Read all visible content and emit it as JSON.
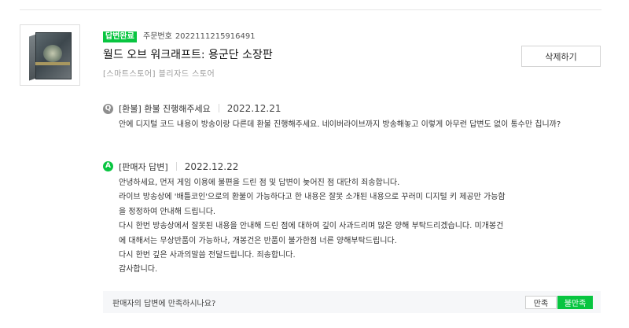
{
  "order": {
    "status_badge": "답변완료",
    "order_label": "주문번호",
    "order_number": "2022111215916491",
    "product_title": "월드 오브 워크래프트: 용군단 소장판",
    "store_name": "[스마트스토어] 블리자드 스토어",
    "delete_label": "삭제하기"
  },
  "question": {
    "badge": "Q",
    "category": "[환불] 환불 진행해주세요",
    "date": "2022.12.21",
    "body": "안에 디지털 코드 내용이 방송이랑 다른데 환불 진행해주세요. 네이버라이브까지 방송해놓고 이렇게 아무런 답변도 없이 통수만 칩니까?"
  },
  "answer": {
    "badge": "A",
    "category": "[판매자 답변]",
    "date": "2022.12.22",
    "lines": [
      "안녕하세요, 먼저 게임 이용에 불편을 드린 점 및 답변이 늦어진 점 대단히 죄송합니다.",
      "라이브 방송상에 '배틀코인'으로의 환불이 가능하다고 한 내용은 잘못 소개된 내용으로 꾸러미 디지털 키 제공만 가능함",
      "을 정정하여 안내해 드립니다.",
      "다시 한번 방송상에서 잘못된 내용을 안내해 드린 점에 대하여 깊이 사과드리며 많은 양해 부탁드리겠습니다. 미개봉건",
      "에 대해서는 무상반품이 가능하나, 개봉건은 반품이 불가한점 너른 양해부탁드립니다.",
      "다시 한번 깊은 사과의말씀 전달드립니다. 죄송합니다.",
      "감사합니다."
    ]
  },
  "survey": {
    "question": "판매자의 답변에 만족하시나요?",
    "yes_label": "만족",
    "no_label": "불만족"
  },
  "colors": {
    "accent": "#08c540",
    "q_badge": "#8e8e8e"
  }
}
